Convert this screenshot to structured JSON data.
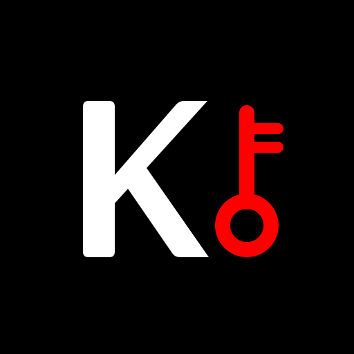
{
  "logo": {
    "letter": "K",
    "letter_color": "#ffffff",
    "key_color": "#ff0000",
    "background_color": "#000000",
    "icon": "key-icon"
  }
}
